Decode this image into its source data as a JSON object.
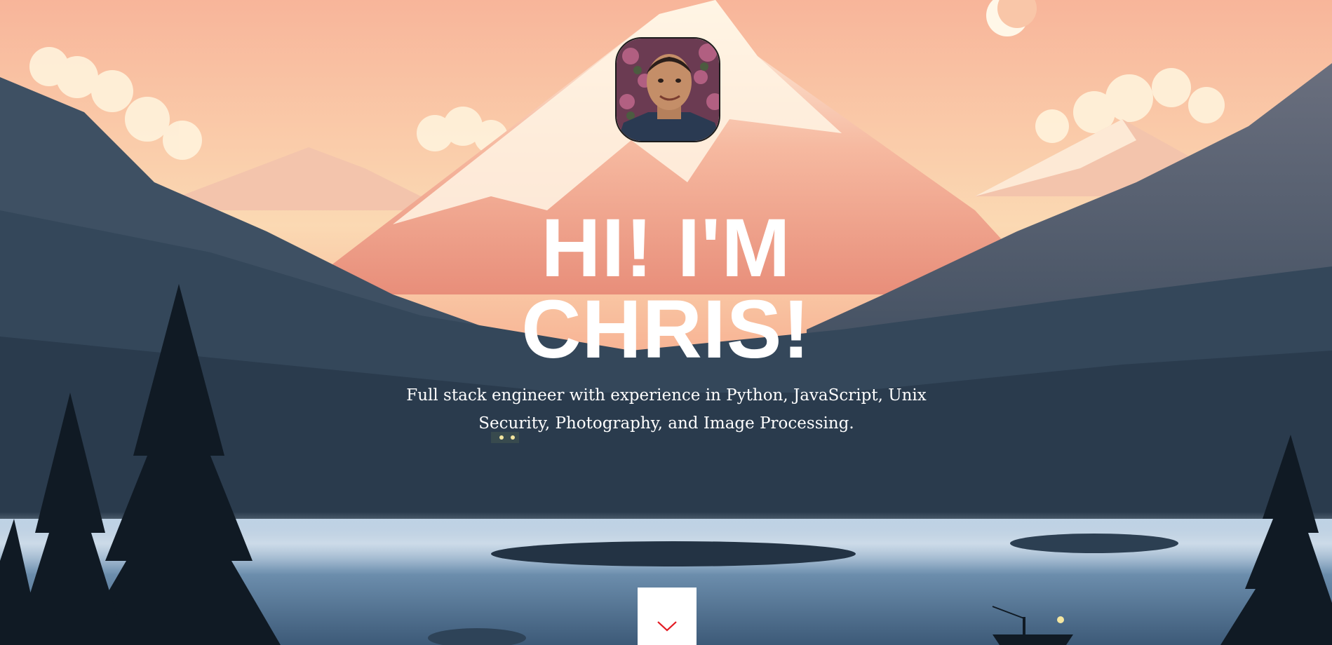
{
  "hero": {
    "headline_line1": "HI! I'M",
    "headline_line2": "CHRIS!",
    "tagline": "Full stack engineer with experience in Python, JavaScript, Unix Security, Photography, and Image Processing.",
    "scroll_icon": "chevron-down-icon",
    "accent_color": "#e31b23"
  }
}
